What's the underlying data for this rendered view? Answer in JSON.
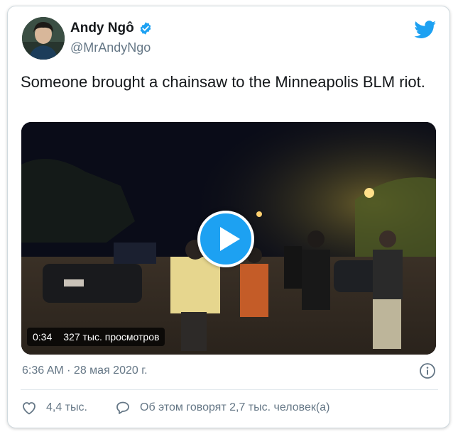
{
  "author": {
    "name": "Andy Ngô",
    "handle": "@MrAndyNgo",
    "verified": true
  },
  "tweet": {
    "text": "Someone brought a chainsaw to the Minneapolis BLM riot."
  },
  "video": {
    "duration": "0:34",
    "views": "327 тыс. просмотров"
  },
  "meta": {
    "timestamp": "6:36 AM · 28 мая 2020 г."
  },
  "actions": {
    "likes": "4,4 тыс.",
    "discussion": "Об этом говорят 2,7 тыс. человек(а)"
  },
  "colors": {
    "brand": "#1da1f2",
    "secondary_text": "#657786"
  },
  "icons": [
    "verified-badge-icon",
    "twitter-bird-icon",
    "play-icon",
    "info-icon",
    "heart-icon",
    "comment-icon"
  ]
}
